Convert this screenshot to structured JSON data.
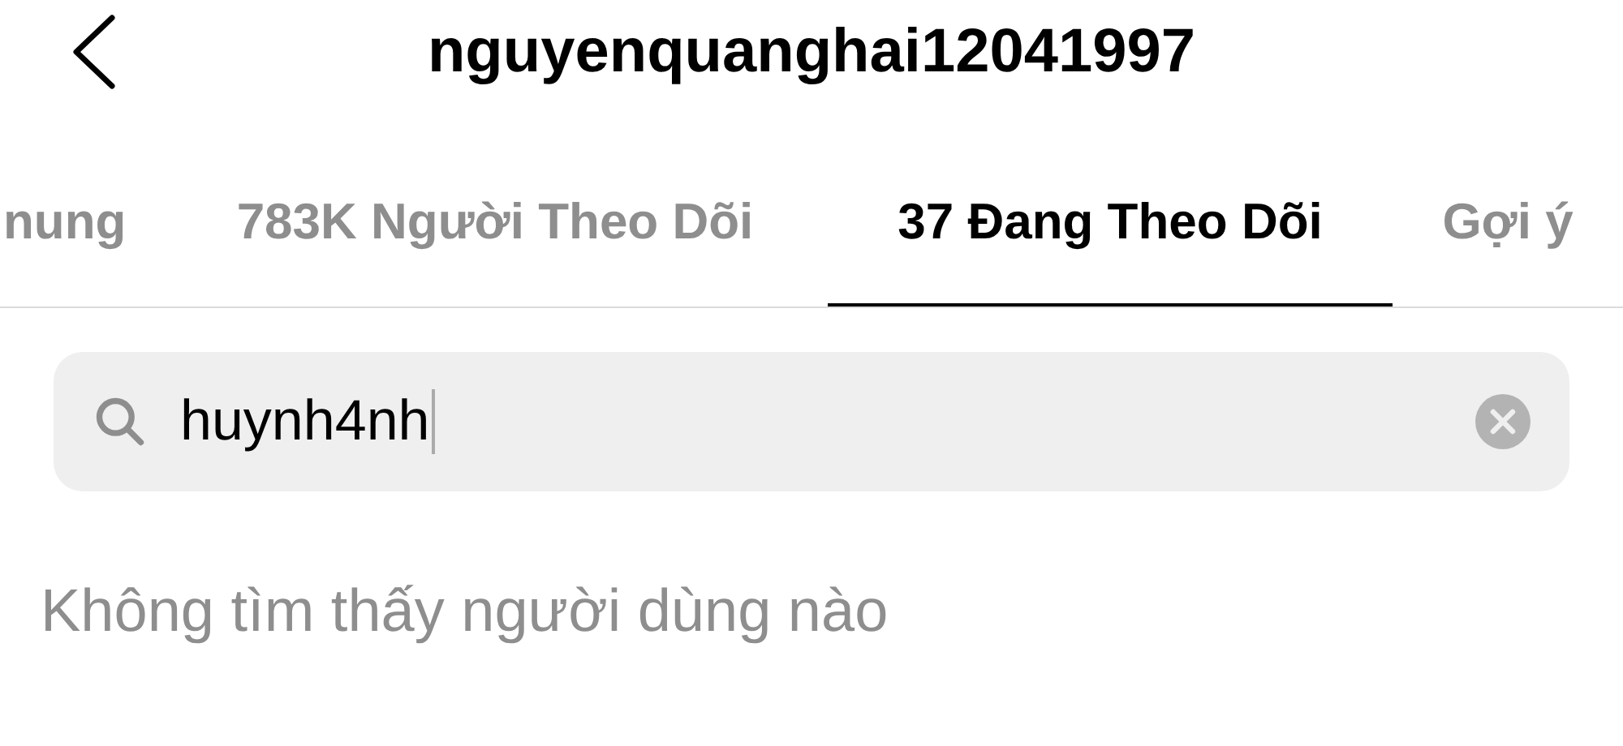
{
  "header": {
    "title": "nguyenquanghai12041997"
  },
  "tabs": [
    {
      "label": "nung",
      "selected": false
    },
    {
      "label": "783K Người Theo Dõi",
      "selected": false
    },
    {
      "label": "37 Đang Theo Dõi",
      "selected": true
    },
    {
      "label": "Gợi ý",
      "selected": false
    }
  ],
  "search": {
    "value": "huynh4nh",
    "focused": true
  },
  "empty_message": "Không tìm thấy người dùng nào"
}
